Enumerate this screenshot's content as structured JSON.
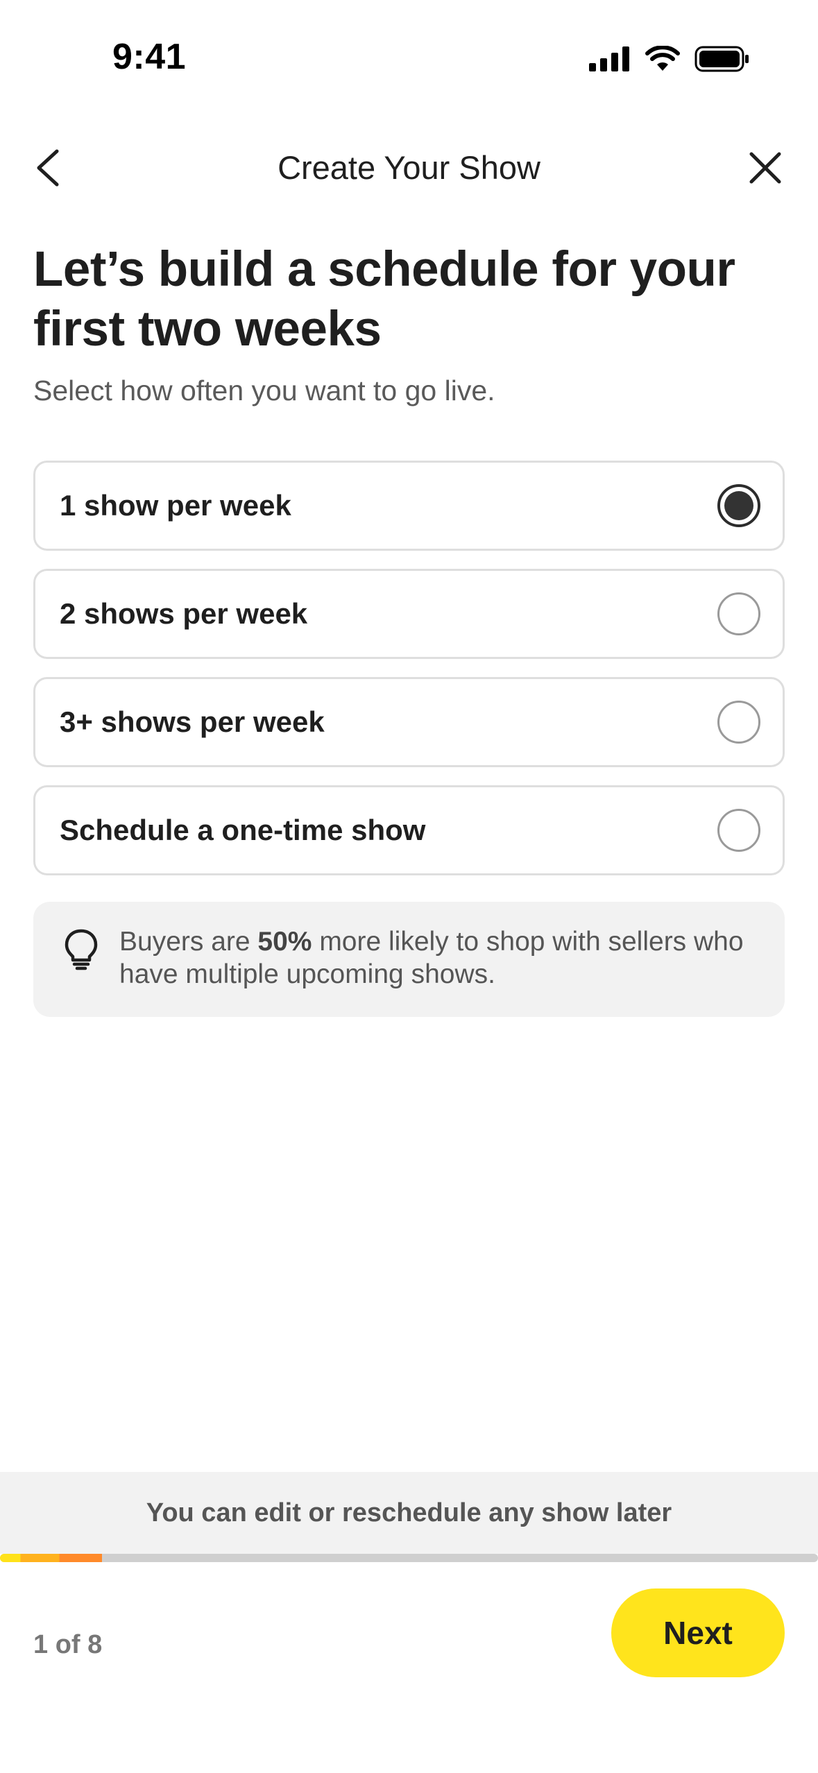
{
  "status_bar": {
    "time": "9:41"
  },
  "nav": {
    "title": "Create Your Show"
  },
  "heading": "Let’s build a schedule for your first two weeks",
  "subheading": "Select how often you want to go live.",
  "options": [
    {
      "label": "1 show per week",
      "selected": true
    },
    {
      "label": "2 shows per week",
      "selected": false
    },
    {
      "label": "3+ shows per week",
      "selected": false
    },
    {
      "label": "Schedule a one-time show",
      "selected": false
    }
  ],
  "tip": {
    "prefix": "Buyers are ",
    "highlight": "50%",
    "suffix": " more likely to shop with sellers who have multiple upcoming shows."
  },
  "footer": {
    "banner": "You can edit or reschedule any show later",
    "step": "1 of 8",
    "progress": 0.125,
    "next_label": "Next"
  },
  "colors": {
    "accent": "#ffe41c",
    "progress_orange": "#ff8a2a"
  },
  "icons": [
    "signal-icon",
    "wifi-icon",
    "battery-icon",
    "back-chevron-icon",
    "close-icon",
    "lightbulb-icon"
  ]
}
